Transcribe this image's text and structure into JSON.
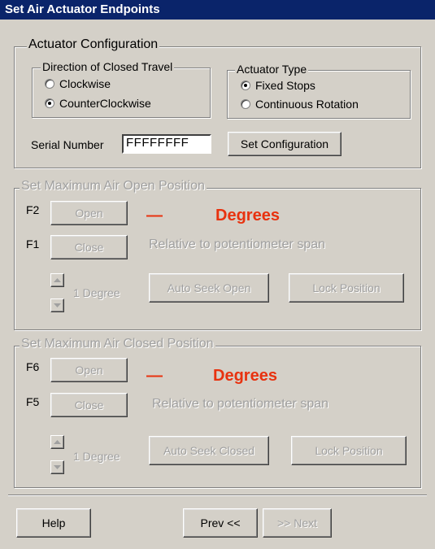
{
  "window": {
    "title": "Set Air Actuator Endpoints"
  },
  "config": {
    "legend": "Actuator Configuration",
    "direction": {
      "legend": "Direction of Closed Travel",
      "options": [
        "Clockwise",
        "CounterClockwise"
      ],
      "selected": "CounterClockwise"
    },
    "actuator_type": {
      "legend": "Actuator Type",
      "options": [
        "Fixed Stops",
        "Continuous Rotation"
      ],
      "selected": "Fixed Stops"
    },
    "serial_label": "Serial Number",
    "serial_value": "FFFFFFFF",
    "set_button": "Set Configuration"
  },
  "open_group": {
    "legend": "Set Maximum Air Open Position",
    "f_open": "F2",
    "open_btn": "Open",
    "f_close": "F1",
    "close_btn": "Close",
    "dash": "—",
    "degrees": "Degrees",
    "relative": "Relative to potentiometer span",
    "step": "1 Degree",
    "auto_seek": "Auto Seek Open",
    "lock": "Lock Position"
  },
  "closed_group": {
    "legend": "Set Maximum Air Closed Position",
    "f_open": "F6",
    "open_btn": "Open",
    "f_close": "F5",
    "close_btn": "Close",
    "dash": "—",
    "degrees": "Degrees",
    "relative": "Relative to potentiometer span",
    "step": "1 Degree",
    "auto_seek": "Auto Seek Closed",
    "lock": "Lock Position"
  },
  "footer": {
    "help": "Help",
    "prev": "Prev <<",
    "next": ">> Next"
  }
}
